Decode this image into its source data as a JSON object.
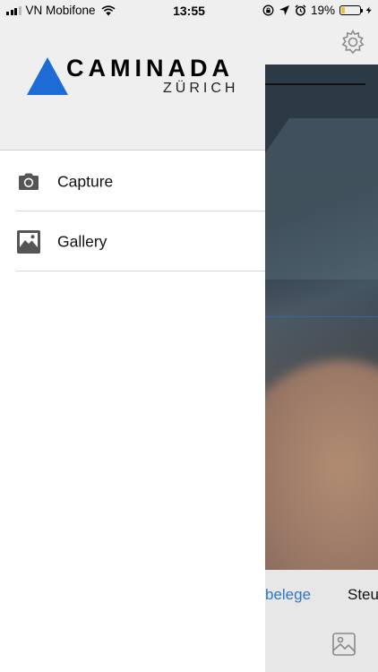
{
  "status_bar": {
    "carrier": "VN Mobifone",
    "time": "13:55",
    "battery_percent_text": "19%",
    "battery_level": 0.19,
    "icons": [
      "signal-icon",
      "wifi-icon",
      "lock-rotation-icon",
      "location-icon",
      "alarm-icon",
      "battery-icon",
      "charging-icon"
    ]
  },
  "drawer": {
    "logo": {
      "wordmark": "CAMINADA",
      "subtitle": "ZÜRICH",
      "brand_color": "#1e6bd6"
    },
    "menu": [
      {
        "label": "Capture",
        "icon": "camera-icon"
      },
      {
        "label": "Gallery",
        "icon": "image-icon"
      }
    ]
  },
  "background_app": {
    "tab_active_label": "belege",
    "tab_other_label": "Steu",
    "accent_color": "#2f76c6",
    "icons": [
      "gear-icon",
      "gallery-icon"
    ]
  }
}
